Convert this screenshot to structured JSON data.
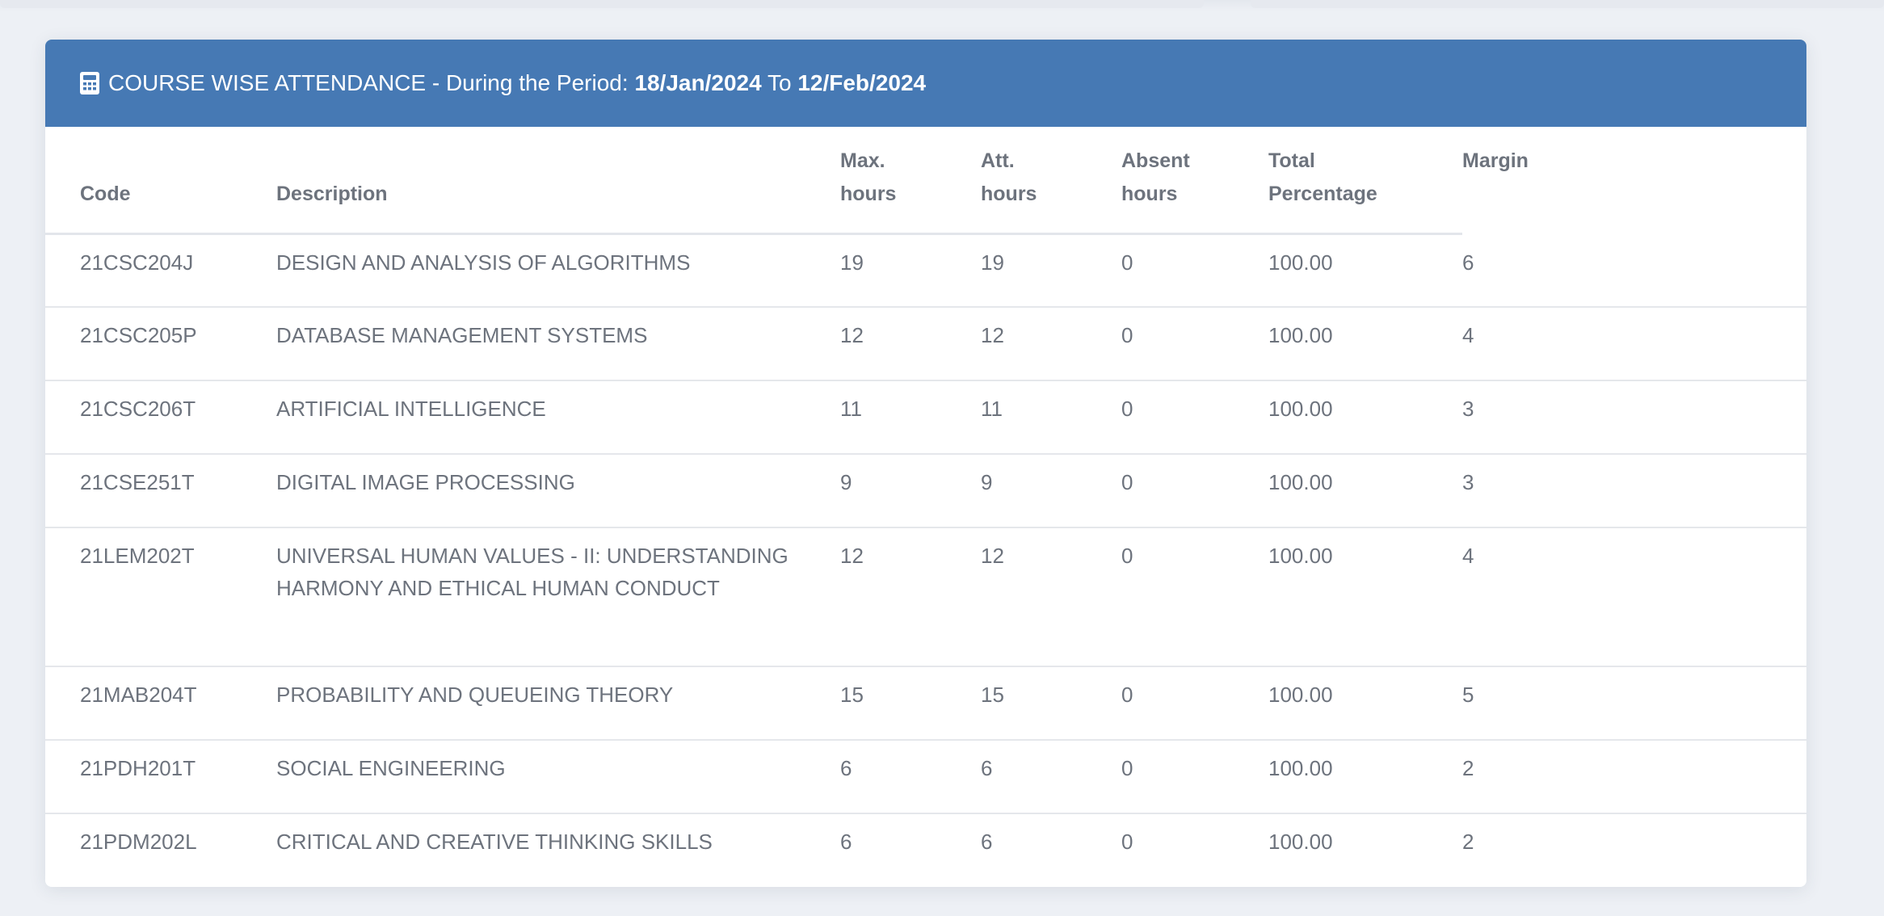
{
  "header": {
    "title_prefix": "COURSE WISE ATTENDANCE - During the Period: ",
    "from_date": "18/Jan/2024",
    "to_label": " To ",
    "to_date": "12/Feb/2024",
    "icon": "calculator-icon",
    "background_color": "#4679b4"
  },
  "table": {
    "columns": {
      "code": "Code",
      "description": "Description",
      "max_hours": [
        "Max.",
        "hours"
      ],
      "att_hours": [
        "Att.",
        "hours"
      ],
      "absent_hours": [
        "Absent",
        "hours"
      ],
      "total_percentage": [
        "Total",
        "Percentage"
      ],
      "margin": "Margin"
    },
    "rows": [
      {
        "code": "21CSC204J",
        "description": "DESIGN AND ANALYSIS OF ALGORITHMS",
        "max": "19",
        "att": "19",
        "absent": "0",
        "total": "100.00",
        "margin": "6"
      },
      {
        "code": "21CSC205P",
        "description": "DATABASE MANAGEMENT SYSTEMS",
        "max": "12",
        "att": "12",
        "absent": "0",
        "total": "100.00",
        "margin": "4"
      },
      {
        "code": "21CSC206T",
        "description": "ARTIFICIAL INTELLIGENCE",
        "max": "11",
        "att": "11",
        "absent": "0",
        "total": "100.00",
        "margin": "3"
      },
      {
        "code": "21CSE251T",
        "description": "DIGITAL IMAGE PROCESSING",
        "max": "9",
        "att": "9",
        "absent": "0",
        "total": "100.00",
        "margin": "3"
      },
      {
        "code": "21LEM202T",
        "description": "UNIVERSAL HUMAN VALUES - II: UNDERSTANDING HARMONY AND ETHICAL HUMAN CONDUCT",
        "max": "12",
        "att": "12",
        "absent": "0",
        "total": "100.00",
        "margin": "4"
      },
      {
        "code": "21MAB204T",
        "description": "PROBABILITY AND QUEUEING THEORY",
        "max": "15",
        "att": "15",
        "absent": "0",
        "total": "100.00",
        "margin": "5"
      },
      {
        "code": "21PDH201T",
        "description": "SOCIAL ENGINEERING",
        "max": "6",
        "att": "6",
        "absent": "0",
        "total": "100.00",
        "margin": "2"
      },
      {
        "code": "21PDM202L",
        "description": "CRITICAL AND CREATIVE THINKING SKILLS",
        "max": "6",
        "att": "6",
        "absent": "0",
        "total": "100.00",
        "margin": "2"
      }
    ]
  }
}
